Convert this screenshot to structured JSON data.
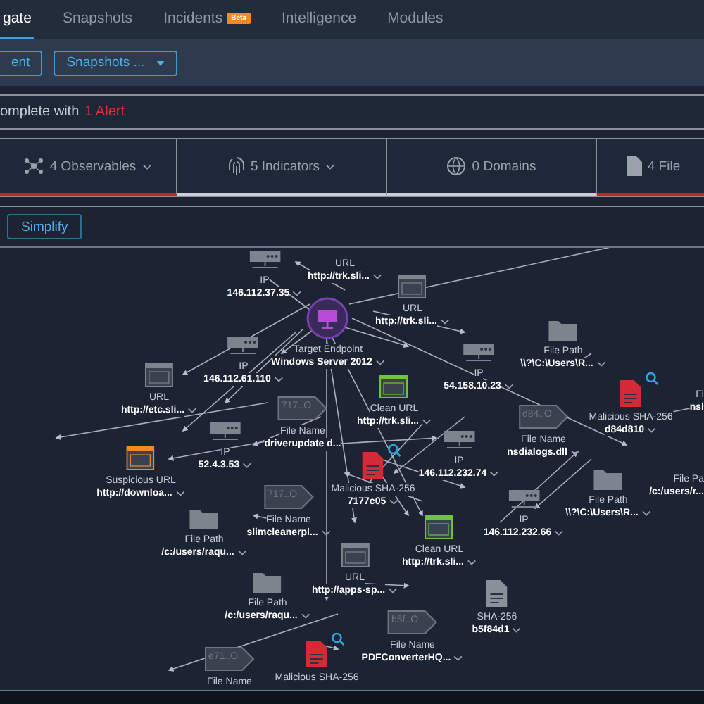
{
  "nav": {
    "tabs": [
      {
        "label": "gate",
        "selected": true
      },
      {
        "label": "Snapshots",
        "selected": false
      },
      {
        "label": "Incidents",
        "selected": false,
        "badge": "Beta"
      },
      {
        "label": "Intelligence",
        "selected": false
      },
      {
        "label": "Modules",
        "selected": false
      }
    ]
  },
  "toolbar": {
    "buttons": [
      {
        "label": "ent",
        "caret": false
      },
      {
        "label": "Snapshots ...",
        "caret": true
      }
    ]
  },
  "status": {
    "text": "omplete with",
    "alert": "1 Alert"
  },
  "summary": [
    {
      "kind": "observables",
      "label": "4 Observables",
      "dropdown": true,
      "alert": true
    },
    {
      "kind": "indicators",
      "label": "5 Indicators",
      "dropdown": true,
      "alert": false
    },
    {
      "kind": "domains",
      "label": "0 Domains",
      "dropdown": false,
      "alert": false
    },
    {
      "kind": "files",
      "label": "4 File",
      "dropdown": false,
      "alert": true
    }
  ],
  "simplify": {
    "label": "Simplify"
  },
  "graph": {
    "nodes": [
      {
        "kind": "host",
        "type": "IP",
        "value": "146.112.37.35",
        "dropdown": true
      },
      {
        "kind": "text",
        "type": "URL",
        "value": "http://trk.sli...",
        "dropdown": true
      },
      {
        "kind": "endpoint",
        "type": "Target Endpoint",
        "value": "Windows Server 2012",
        "dropdown": true
      },
      {
        "kind": "host",
        "type": "IP",
        "value": "146.112.61.110",
        "dropdown": true
      },
      {
        "kind": "url",
        "type": "URL",
        "value": "http://etc.sli...",
        "dropdown": true
      },
      {
        "kind": "url",
        "type": "URL",
        "value": "http://trk.sli...",
        "dropdown": true
      },
      {
        "kind": "clean_url",
        "type": "Clean URL",
        "value": "http://trk.sli...",
        "dropdown": true
      },
      {
        "kind": "host",
        "type": "IP",
        "value": "54.158.10.23",
        "dropdown": true
      },
      {
        "kind": "folder",
        "type": "File Path",
        "value": "\\\\?\\C:\\Users\\R...",
        "dropdown": true
      },
      {
        "kind": "tag",
        "type": "File Name",
        "value": "nsdialogs.dll",
        "tag": "d84..O",
        "dropdown": true
      },
      {
        "kind": "malicious",
        "type": "Malicious SHA-256",
        "value": "d84d810",
        "dropdown": true,
        "search": true
      },
      {
        "kind": "edge",
        "type": "Fi",
        "value": "nsl",
        "dropdown": false
      },
      {
        "kind": "edge",
        "type": "File Pa",
        "value": "/c:/users/r...",
        "dropdown": false
      },
      {
        "kind": "tag",
        "type": "File Name",
        "value": "driverupdate d...",
        "tag": "717..O",
        "dropdown": false
      },
      {
        "kind": "host",
        "type": "IP",
        "value": "52.4.3.53",
        "dropdown": true
      },
      {
        "kind": "suspicious_url",
        "type": "Suspicious URL",
        "value": "http://downloa...",
        "dropdown": true
      },
      {
        "kind": "malicious",
        "type": "Malicious SHA-256",
        "value": "7177c05",
        "dropdown": true,
        "search": true
      },
      {
        "kind": "host",
        "type": "IP",
        "value": "146.112.232.74",
        "dropdown": true
      },
      {
        "kind": "tag",
        "type": "File Name",
        "value": "slimcleanerpl...",
        "tag": "717..O",
        "dropdown": true
      },
      {
        "kind": "folder",
        "type": "File Path",
        "value": "/c:/users/raqu...",
        "dropdown": true
      },
      {
        "kind": "clean_url",
        "type": "Clean URL",
        "value": "http://trk.sli...",
        "dropdown": true
      },
      {
        "kind": "host",
        "type": "IP",
        "value": "146.112.232.66",
        "dropdown": true
      },
      {
        "kind": "folder",
        "type": "File Path",
        "value": "\\\\?\\C:\\Users\\R...",
        "dropdown": true
      },
      {
        "kind": "url",
        "type": "URL",
        "value": "http://apps-sp...",
        "dropdown": true
      },
      {
        "kind": "folder",
        "type": "File Path",
        "value": "/c:/users/raqu...",
        "dropdown": true
      },
      {
        "kind": "tag",
        "type": "File Name",
        "value": "PDFConverterHQ...",
        "tag": "b5f..O",
        "dropdown": true
      },
      {
        "kind": "file",
        "type": "SHA-256",
        "value": "b5f84d1",
        "dropdown": true
      },
      {
        "kind": "tag",
        "type": "File Name",
        "tag": "e71..O"
      },
      {
        "kind": "malicious",
        "type": "Malicious SHA-256",
        "search": true
      }
    ]
  }
}
